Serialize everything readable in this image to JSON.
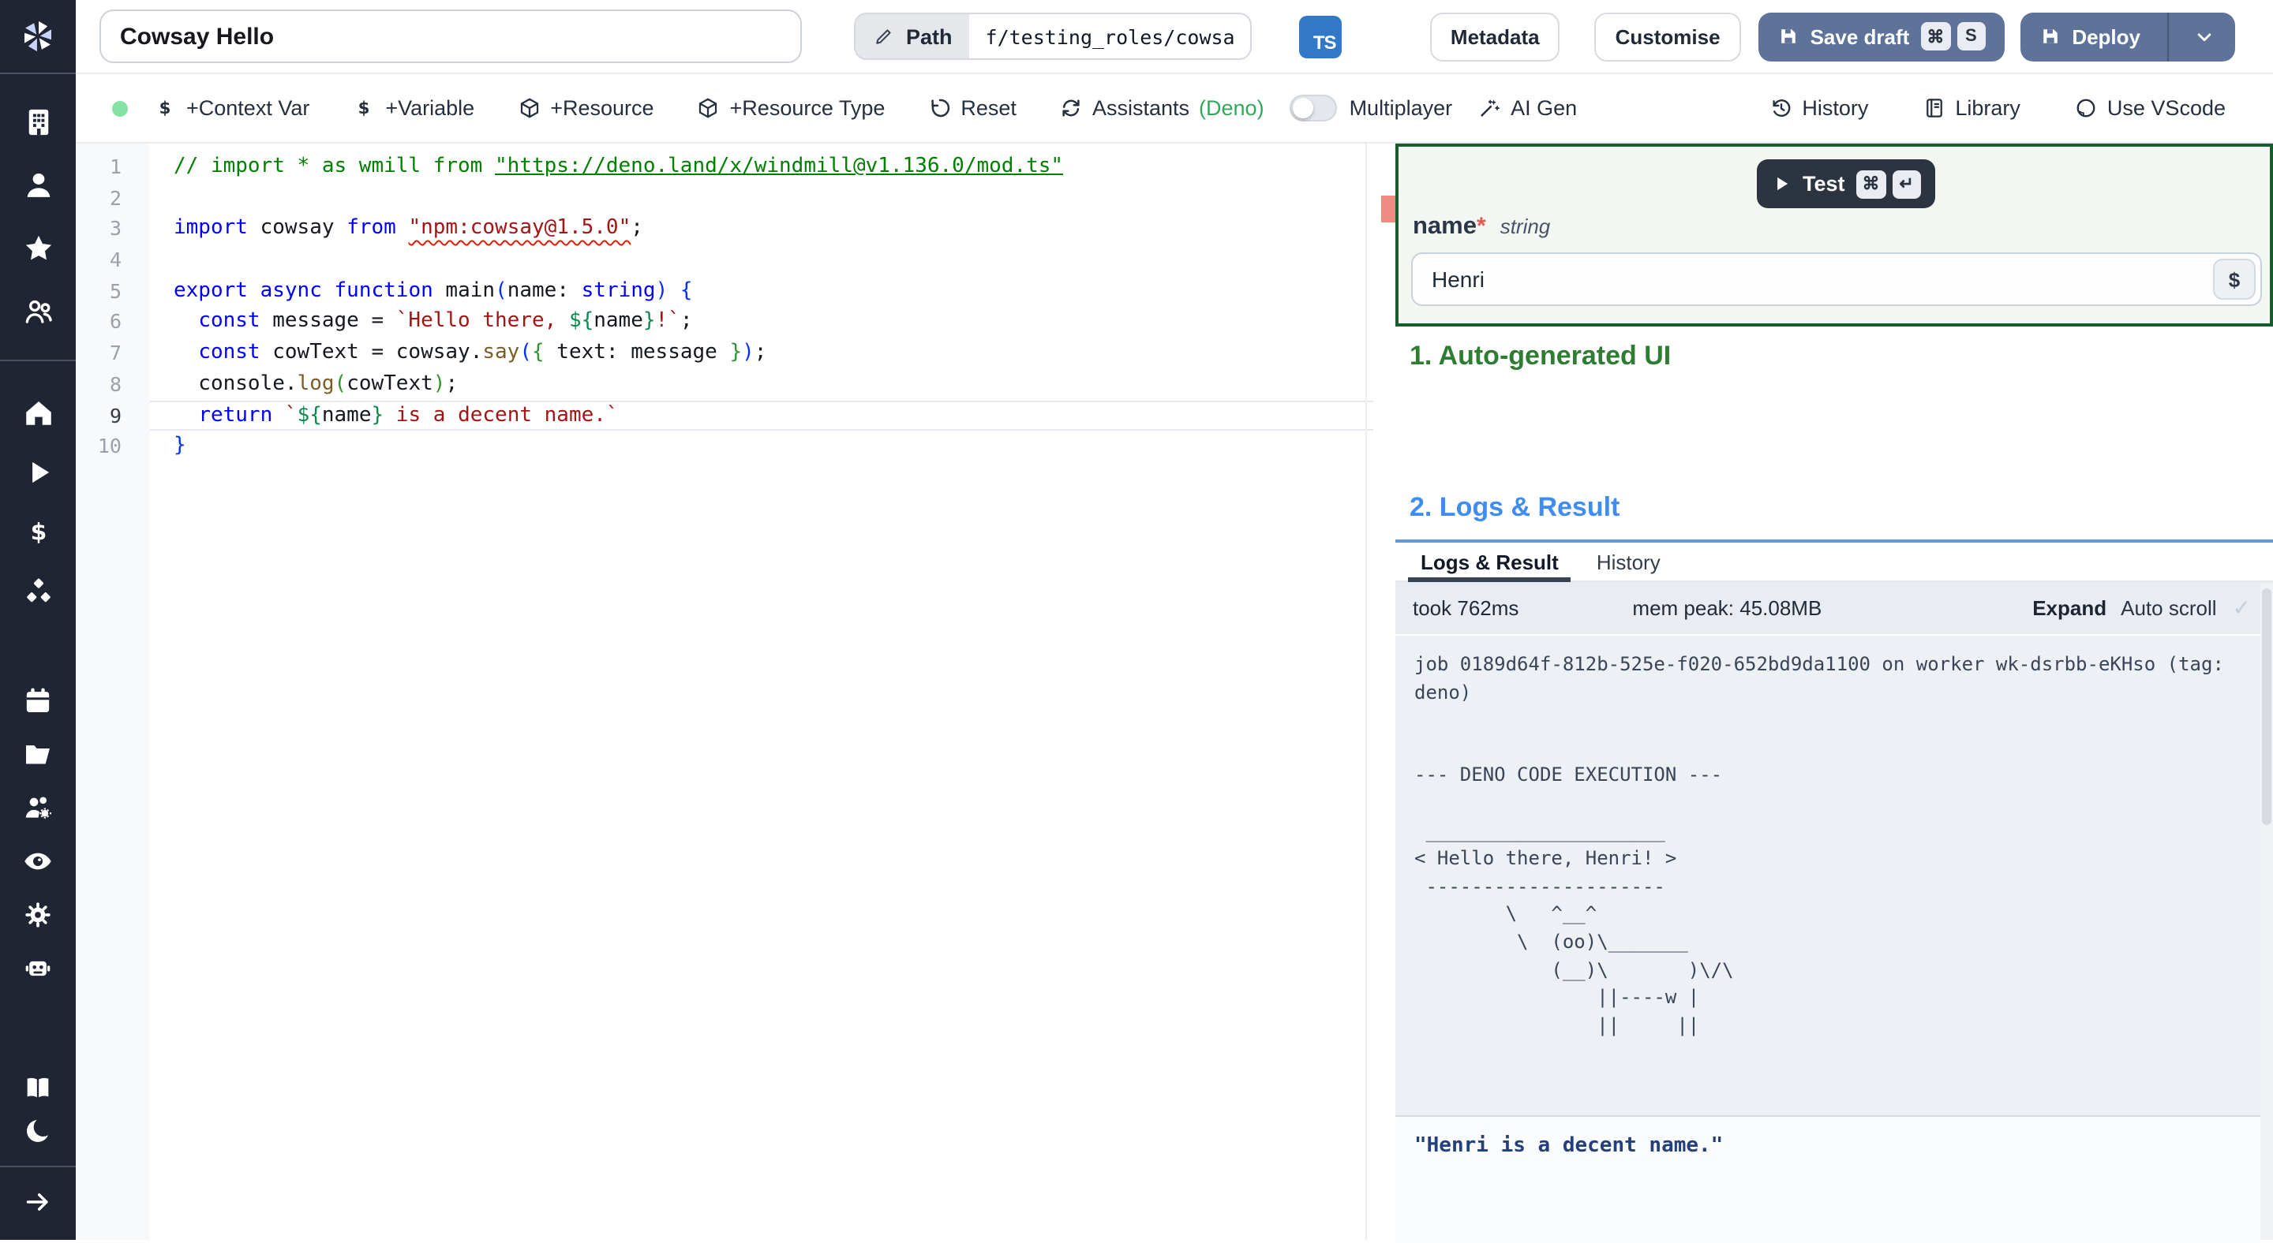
{
  "colors": {
    "accent_button": "#5f7399",
    "ts_badge": "#3178c6",
    "section1_green": "#2e7d32",
    "section2_blue": "#3f8cf3",
    "deno_green": "#31a85a",
    "status_dot": "#84e3a4",
    "error_red": "#ef8b82",
    "panel_border_green": "#1b5c2e",
    "logs_top_border": "#5e9bd6"
  },
  "sidebar": {
    "logo_icon": "windmill-logo",
    "groups": {
      "workspace": [
        "building",
        "user",
        "star",
        "users"
      ],
      "primary": [
        "home",
        "play",
        "dollar",
        "cubes"
      ],
      "tools": [
        "calendar",
        "folder",
        "users-gear",
        "eye",
        "gear",
        "robot"
      ],
      "footer": [
        "book",
        "moon"
      ]
    },
    "expand_icon": "arrow-right"
  },
  "topbar": {
    "title_value": "Cowsay Hello",
    "path_button": {
      "icon": "pencil",
      "label": "Path",
      "value": "f/testing_roles/cowsa"
    },
    "lang_badge": "TS",
    "metadata_label": "Metadata",
    "customise_label": "Customise",
    "save_draft": {
      "icon": "save",
      "label": "Save draft",
      "kbd": [
        "⌘",
        "S"
      ]
    },
    "deploy": {
      "icon": "save",
      "label": "Deploy",
      "chevron_icon": "chevron-down"
    }
  },
  "toolbar": {
    "items": [
      {
        "icon": "dollar",
        "label": "+Context Var"
      },
      {
        "icon": "dollar",
        "label": "+Variable"
      },
      {
        "icon": "package",
        "label": "+Resource"
      },
      {
        "icon": "package",
        "label": "+Resource Type"
      },
      {
        "icon": "undo",
        "label": "Reset"
      },
      {
        "icon": "refresh",
        "label": "Assistants ",
        "suffix": "(Deno)"
      }
    ],
    "multiplayer": {
      "label": "Multiplayer",
      "enabled": false
    },
    "ai_gen": {
      "icon": "wand",
      "label": "AI Gen"
    },
    "right_items": [
      {
        "icon": "history",
        "label": "History"
      },
      {
        "icon": "library",
        "label": "Library"
      },
      {
        "icon": "github",
        "label": "Use VScode"
      }
    ]
  },
  "editor": {
    "current_line": 9,
    "lines": [
      {
        "num": 1,
        "tokens": [
          {
            "c": "cm",
            "t": "// import * as wmill from "
          },
          {
            "c": "cm u",
            "t": "\"https://deno.land/x/windmill@v1.136.0/mod.ts\""
          }
        ]
      },
      {
        "num": 2,
        "tokens": []
      },
      {
        "num": 3,
        "tokens": [
          {
            "c": "kw",
            "t": "import"
          },
          {
            "c": "pl",
            "t": " cowsay "
          },
          {
            "c": "kw",
            "t": "from"
          },
          {
            "c": "pl",
            "t": " "
          },
          {
            "c": "st sq",
            "t": "\"npm:cowsay@1.5.0\""
          },
          {
            "c": "pl",
            "t": ";"
          }
        ]
      },
      {
        "num": 4,
        "tokens": []
      },
      {
        "num": 5,
        "tokens": [
          {
            "c": "kw",
            "t": "export"
          },
          {
            "c": "pl",
            "t": " "
          },
          {
            "c": "kw",
            "t": "async"
          },
          {
            "c": "pl",
            "t": " "
          },
          {
            "c": "kw",
            "t": "function"
          },
          {
            "c": "pl",
            "t": " main"
          },
          {
            "c": "b1",
            "t": "("
          },
          {
            "c": "pl",
            "t": "name: "
          },
          {
            "c": "kw",
            "t": "string"
          },
          {
            "c": "b1",
            "t": ")"
          },
          {
            "c": "pl",
            "t": " "
          },
          {
            "c": "b1",
            "t": "{"
          }
        ]
      },
      {
        "num": 6,
        "tokens": [
          {
            "c": "pl",
            "t": "  "
          },
          {
            "c": "kw",
            "t": "const"
          },
          {
            "c": "pl",
            "t": " message = "
          },
          {
            "c": "st",
            "t": "`Hello there, "
          },
          {
            "c": "td",
            "t": "${"
          },
          {
            "c": "pl",
            "t": "name"
          },
          {
            "c": "td",
            "t": "}"
          },
          {
            "c": "st",
            "t": "!`"
          },
          {
            "c": "pl",
            "t": ";"
          }
        ]
      },
      {
        "num": 7,
        "tokens": [
          {
            "c": "pl",
            "t": "  "
          },
          {
            "c": "kw",
            "t": "const"
          },
          {
            "c": "pl",
            "t": " cowText = cowsay."
          },
          {
            "c": "mt",
            "t": "say"
          },
          {
            "c": "b1",
            "t": "("
          },
          {
            "c": "b2",
            "t": "{"
          },
          {
            "c": "pl",
            "t": " text: message "
          },
          {
            "c": "b2",
            "t": "}"
          },
          {
            "c": "b1",
            "t": ")"
          },
          {
            "c": "pl",
            "t": ";"
          }
        ]
      },
      {
        "num": 8,
        "tokens": [
          {
            "c": "pl",
            "t": "  console."
          },
          {
            "c": "mt",
            "t": "log"
          },
          {
            "c": "b2",
            "t": "("
          },
          {
            "c": "pl",
            "t": "cowText"
          },
          {
            "c": "b2",
            "t": ")"
          },
          {
            "c": "pl",
            "t": ";"
          }
        ]
      },
      {
        "num": 9,
        "tokens": [
          {
            "c": "pl",
            "t": "  "
          },
          {
            "c": "kw",
            "t": "return"
          },
          {
            "c": "pl",
            "t": " "
          },
          {
            "c": "st",
            "t": "`"
          },
          {
            "c": "td",
            "t": "${"
          },
          {
            "c": "pl",
            "t": "name"
          },
          {
            "c": "td",
            "t": "}"
          },
          {
            "c": "st",
            "t": " is a decent name.`"
          }
        ]
      },
      {
        "num": 10,
        "tokens": [
          {
            "c": "b1",
            "t": "}"
          }
        ]
      }
    ]
  },
  "run_panel": {
    "test_button": {
      "icon": "play",
      "label": "Test",
      "kbd": [
        "⌘",
        "↵"
      ]
    },
    "schema_field": {
      "name": "name",
      "required_mark": "*",
      "type": "string",
      "value": "Henri",
      "insert_var_label": "$"
    },
    "section1_title": "1. Auto-generated UI",
    "section2_title": "2. Logs & Result",
    "tabs": [
      {
        "label": "Logs & Result",
        "active": true
      },
      {
        "label": "History",
        "active": false
      }
    ],
    "status": {
      "duration": "took 762ms",
      "mem": "mem peak: 45.08MB",
      "expand_label": "Expand",
      "autoscroll_label": "Auto scroll",
      "autoscroll_check": "✓"
    },
    "log_lines": [
      "job 0189d64f-812b-525e-f020-652bd9da1100 on worker wk-dsrbb-eKHso (tag:",
      "deno)",
      "",
      "",
      "--- DENO CODE EXECUTION ---",
      "",
      " _____________________",
      "< Hello there, Henri! >",
      " ---------------------",
      "        \\   ^__^",
      "         \\  (oo)\\_______",
      "            (__)\\       )\\/\\",
      "                ||----w |",
      "                ||     ||"
    ],
    "result_value": "\"Henri is a decent name.\""
  }
}
